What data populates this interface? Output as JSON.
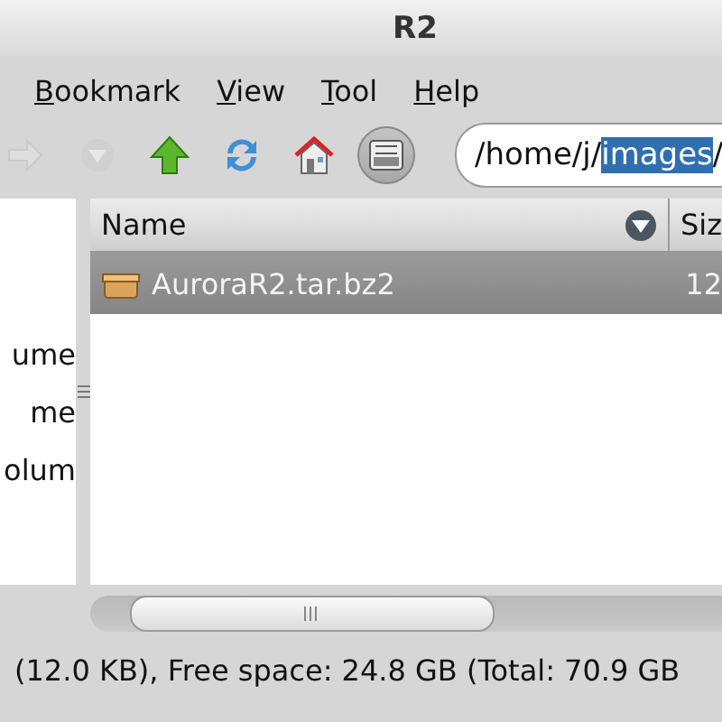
{
  "window": {
    "title": "R2"
  },
  "menu": [
    {
      "label": "Bookmark"
    },
    {
      "label": "View"
    },
    {
      "label": "Tool"
    },
    {
      "label": "Help"
    }
  ],
  "toolbar": [
    {
      "kind": "forward",
      "disabled": true,
      "pressed": false
    },
    {
      "kind": "history",
      "disabled": true,
      "pressed": false
    },
    {
      "kind": "up",
      "disabled": false,
      "pressed": false
    },
    {
      "kind": "reload",
      "disabled": false,
      "pressed": false
    },
    {
      "kind": "home",
      "disabled": false,
      "pressed": false
    },
    {
      "kind": "pane",
      "disabled": false,
      "pressed": true
    }
  ],
  "address": {
    "before": "/home/j/",
    "selection": "images",
    "after": "/"
  },
  "sidebar": {
    "items": [
      {
        "label": "ume"
      },
      {
        "label": "me"
      },
      {
        "label": "olum"
      }
    ]
  },
  "table": {
    "columns": [
      {
        "label": "Name",
        "sorted": true
      },
      {
        "label": "Siz",
        "sorted": false
      }
    ],
    "rows": [
      {
        "name": "AuroraR2.tar.bz2",
        "size": "12",
        "selected": true
      }
    ]
  },
  "status_bar": "(12.0 KB), Free space: 24.8 GB (Total: 70.9 GB"
}
